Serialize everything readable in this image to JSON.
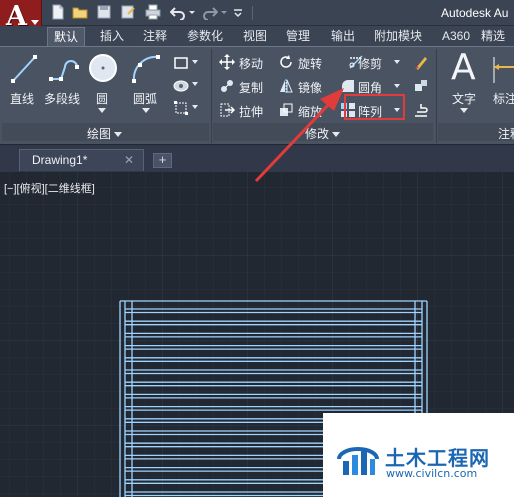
{
  "app": {
    "title": "Autodesk Au",
    "app_letter": "A"
  },
  "tabs": [
    "默认",
    "插入",
    "注释",
    "参数化",
    "视图",
    "管理",
    "输出",
    "附加模块",
    "A360",
    "精选"
  ],
  "draw_panel": {
    "title": "绘图",
    "tools": [
      "直线",
      "多段线",
      "圆",
      "圆弧"
    ]
  },
  "modify_panel": {
    "title": "修改",
    "rows": [
      [
        "移动",
        "旋转",
        "修剪"
      ],
      [
        "复制",
        "镜像",
        "圆角"
      ],
      [
        "拉伸",
        "缩放",
        "阵列"
      ]
    ],
    "highlighted": "修剪"
  },
  "annotation_panel": {
    "title": "注释",
    "tools": [
      "文字",
      "标注"
    ]
  },
  "document": {
    "tab_label": "Drawing1*",
    "close_glyph": "✕",
    "new_tab_glyph": "+"
  },
  "viewport": {
    "label": "[−][俯视][二维线框]"
  },
  "watermark": {
    "title": "土木工程网",
    "url": "www.civilcn.com"
  },
  "colors": {
    "accent_red": "#e23b3b",
    "drawing_lines": "#9fd4ff",
    "app_button": "#8f1d1d"
  }
}
